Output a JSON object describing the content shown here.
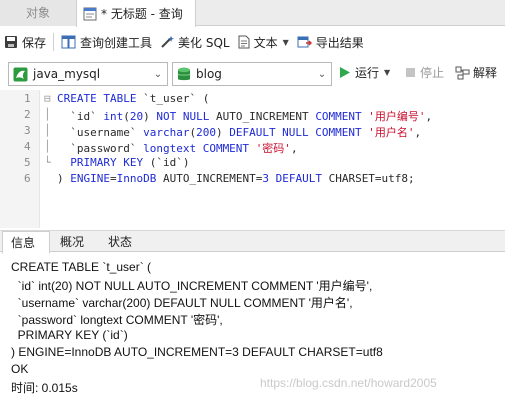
{
  "tabs": {
    "objects": "对象",
    "query": "* 无标题 - 查询"
  },
  "toolbar": {
    "save": "保存",
    "query_builder": "查询创建工具",
    "beautify": "美化 SQL",
    "text": "文本",
    "export": "导出结果"
  },
  "connection": {
    "name": "java_mysql",
    "database": "blog",
    "run": "运行",
    "stop": "停止",
    "explain": "解释"
  },
  "editor": {
    "line_numbers": [
      "1",
      "2",
      "3",
      "4",
      "5",
      "6"
    ],
    "lines": [
      [
        {
          "t": "kw",
          "v": "CREATE TABLE "
        },
        {
          "t": "ident",
          "v": "`t_user` ("
        }
      ],
      [
        {
          "t": "ident",
          "v": "  `id` "
        },
        {
          "t": "kw",
          "v": "int"
        },
        {
          "t": "ident",
          "v": "("
        },
        {
          "t": "kw",
          "v": "20"
        },
        {
          "t": "ident",
          "v": ") "
        },
        {
          "t": "kw",
          "v": "NOT NULL"
        },
        {
          "t": "ident",
          "v": " AUTO_INCREMENT "
        },
        {
          "t": "kw",
          "v": "COMMENT"
        },
        {
          "t": "ident",
          "v": " "
        },
        {
          "t": "str",
          "v": "'用户编号'"
        },
        {
          "t": "ident",
          "v": ","
        }
      ],
      [
        {
          "t": "ident",
          "v": "  `username` "
        },
        {
          "t": "kw",
          "v": "varchar"
        },
        {
          "t": "ident",
          "v": "("
        },
        {
          "t": "kw",
          "v": "200"
        },
        {
          "t": "ident",
          "v": ") "
        },
        {
          "t": "kw",
          "v": "DEFAULT NULL COMMENT"
        },
        {
          "t": "ident",
          "v": " "
        },
        {
          "t": "str",
          "v": "'用户名'"
        },
        {
          "t": "ident",
          "v": ","
        }
      ],
      [
        {
          "t": "ident",
          "v": "  `password` "
        },
        {
          "t": "kw",
          "v": "longtext COMMENT"
        },
        {
          "t": "ident",
          "v": " "
        },
        {
          "t": "str",
          "v": "'密码'"
        },
        {
          "t": "ident",
          "v": ","
        }
      ],
      [
        {
          "t": "ident",
          "v": "  "
        },
        {
          "t": "kw",
          "v": "PRIMARY KEY"
        },
        {
          "t": "ident",
          "v": " (`id`)"
        }
      ],
      [
        {
          "t": "ident",
          "v": ") "
        },
        {
          "t": "kw",
          "v": "ENGINE"
        },
        {
          "t": "ident",
          "v": "="
        },
        {
          "t": "kw",
          "v": "InnoDB"
        },
        {
          "t": "ident",
          "v": " AUTO_INCREMENT="
        },
        {
          "t": "kw",
          "v": "3"
        },
        {
          "t": "ident",
          "v": " "
        },
        {
          "t": "kw",
          "v": "DEFAULT"
        },
        {
          "t": "ident",
          "v": " CHARSET=utf8;"
        }
      ]
    ]
  },
  "results": {
    "tabs": [
      "信息",
      "概况",
      "状态"
    ],
    "messages": [
      "CREATE TABLE `t_user` (",
      "  `id` int(20) NOT NULL AUTO_INCREMENT COMMENT '用户编号',",
      "  `username` varchar(200) DEFAULT NULL COMMENT '用户名',",
      "  `password` longtext COMMENT '密码',",
      "  PRIMARY KEY (`id`)",
      ") ENGINE=InnoDB AUTO_INCREMENT=3 DEFAULT CHARSET=utf8",
      "OK",
      "时间: 0.015s"
    ],
    "watermark": "https://blog.csdn.net/howard2005"
  },
  "colors": {
    "keyword": "#1f2bd6",
    "string": "#c8102e",
    "run_green": "#2fa84f"
  }
}
